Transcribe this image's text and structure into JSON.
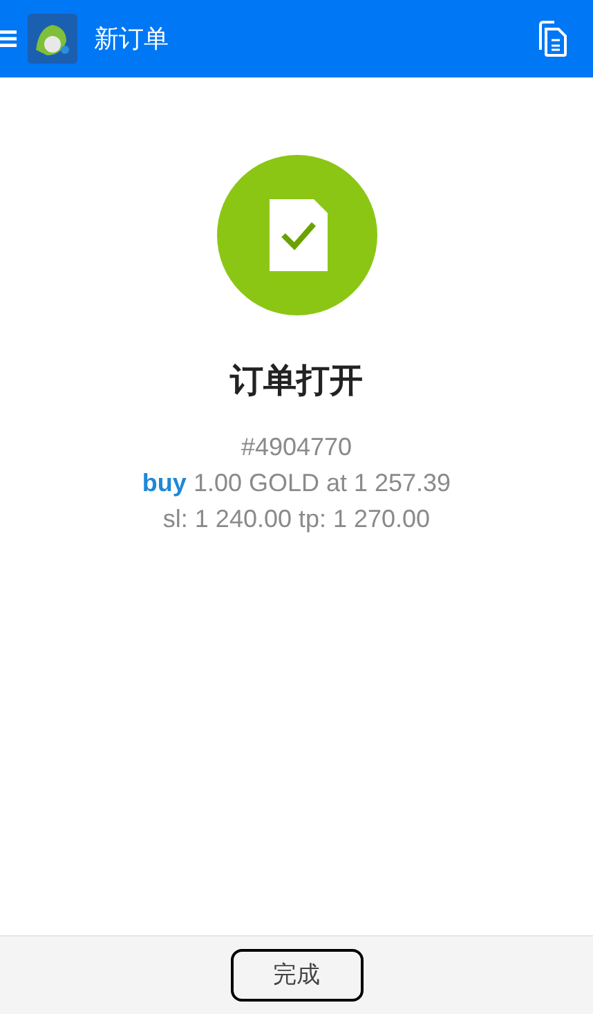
{
  "header": {
    "title": "新订单"
  },
  "result": {
    "title": "订单打开",
    "ticket": "#4904770",
    "side": "buy",
    "details": "1.00 GOLD at 1 257.39",
    "levels": "sl: 1 240.00 tp: 1 270.00"
  },
  "footer": {
    "button": "完成"
  }
}
